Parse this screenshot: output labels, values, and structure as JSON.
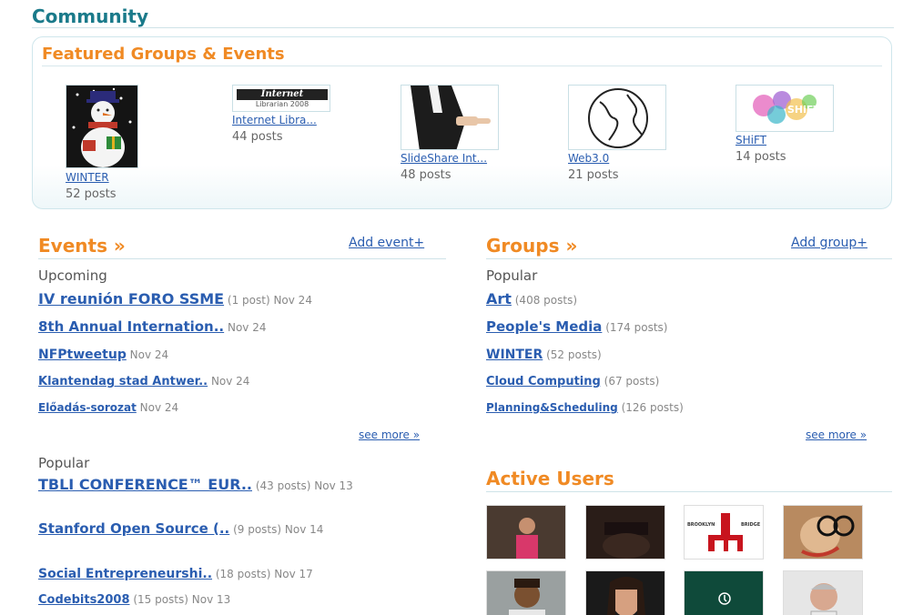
{
  "community": {
    "title": "Community"
  },
  "featured": {
    "title": "Featured Groups & Events",
    "items": [
      {
        "name": "WINTER",
        "count": "52 posts",
        "icon": "snowman-image"
      },
      {
        "name": "Internet Libra...",
        "count": "44 posts",
        "icon": "internet-librarian-logo",
        "logo_top": "Internet",
        "logo_bottom": "Librarian 2008"
      },
      {
        "name": "SlideShare Int...",
        "count": "48 posts",
        "icon": "handshake-image"
      },
      {
        "name": "Web3.0",
        "count": "21 posts",
        "icon": "globe-image"
      },
      {
        "name": "SHiFT",
        "count": "14 posts",
        "icon": "shift-splash-logo",
        "logo_text": "SHiFT"
      }
    ]
  },
  "events": {
    "title": "Events »",
    "add_label": "Add event+",
    "upcoming_label": "Upcoming",
    "upcoming": [
      {
        "name": "IV reunión FORO SSME",
        "meta": "(1 post) Nov 24"
      },
      {
        "name": "8th Annual Internation..",
        "meta": "Nov 24"
      },
      {
        "name": "NFPtweetup",
        "meta": "Nov 24"
      },
      {
        "name": "Klantendag stad Antwer..",
        "meta": "Nov 24"
      },
      {
        "name": "Előadás-sorozat",
        "meta": "Nov 24"
      }
    ],
    "see_more": "see more »",
    "popular_label": "Popular",
    "popular": [
      {
        "name": "TBLI CONFERENCE™ EUR..",
        "meta": "(43 posts) Nov 13"
      },
      {
        "name": "Stanford Open Source (..",
        "meta": "(9 posts) Nov 14"
      },
      {
        "name": "Social Entrepreneurshi..",
        "meta": "(18 posts) Nov 17"
      },
      {
        "name": "Codebits2008",
        "meta": "(15 posts) Nov 13"
      }
    ]
  },
  "groups": {
    "title": "Groups »",
    "add_label": "Add group+",
    "popular_label": "Popular",
    "items": [
      {
        "name": "Art",
        "meta": "(408 posts)"
      },
      {
        "name": "People's Media",
        "meta": "(174 posts)"
      },
      {
        "name": "WINTER",
        "meta": "(52 posts)"
      },
      {
        "name": "Cloud Computing",
        "meta": "(67 posts)"
      },
      {
        "name": "Planning&Scheduling",
        "meta": "(126 posts)"
      }
    ],
    "see_more": "see more »"
  },
  "active_users": {
    "title": "Active Users",
    "users": [
      {
        "icon": "user-avatar-1"
      },
      {
        "icon": "user-avatar-2"
      },
      {
        "icon": "brooklyn-bridge-avatar",
        "text_left": "BROOKLYN",
        "text_right": "BRIDGE"
      },
      {
        "icon": "user-avatar-glasses"
      },
      {
        "icon": "user-avatar-5"
      },
      {
        "icon": "user-avatar-6"
      },
      {
        "icon": "user-avatar-7"
      },
      {
        "icon": "user-avatar-8"
      }
    ]
  },
  "colors": {
    "accent_orange": "#f08a24",
    "link_blue": "#2a5db0",
    "heading_teal": "#1a7a8a"
  }
}
